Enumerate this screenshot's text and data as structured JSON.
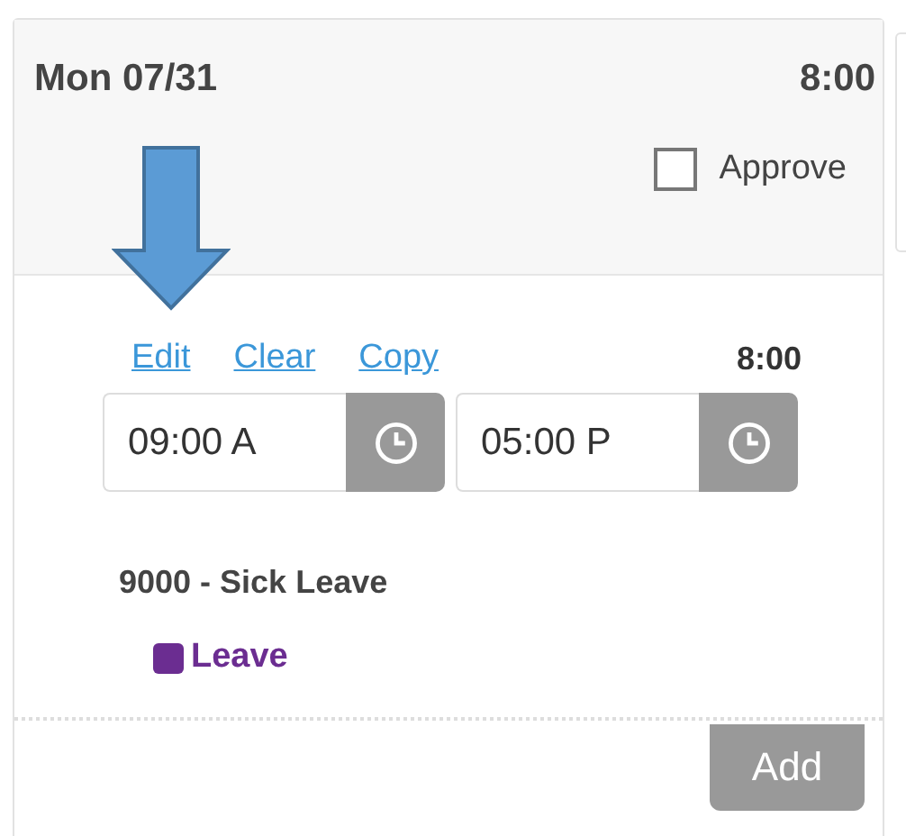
{
  "day": {
    "title": "Mon 07/31",
    "total": "8:00",
    "approve": {
      "label": "Approve",
      "checked": false
    }
  },
  "entry": {
    "links": [
      "Edit",
      "Clear",
      "Copy"
    ],
    "total": "8:00",
    "times": [
      {
        "value": "09:00 A"
      },
      {
        "value": "05:00 P"
      }
    ],
    "code": "9000 - Sick Leave",
    "tag": {
      "label": "Leave",
      "color": "#6b2d91"
    }
  },
  "add_button": "Add"
}
